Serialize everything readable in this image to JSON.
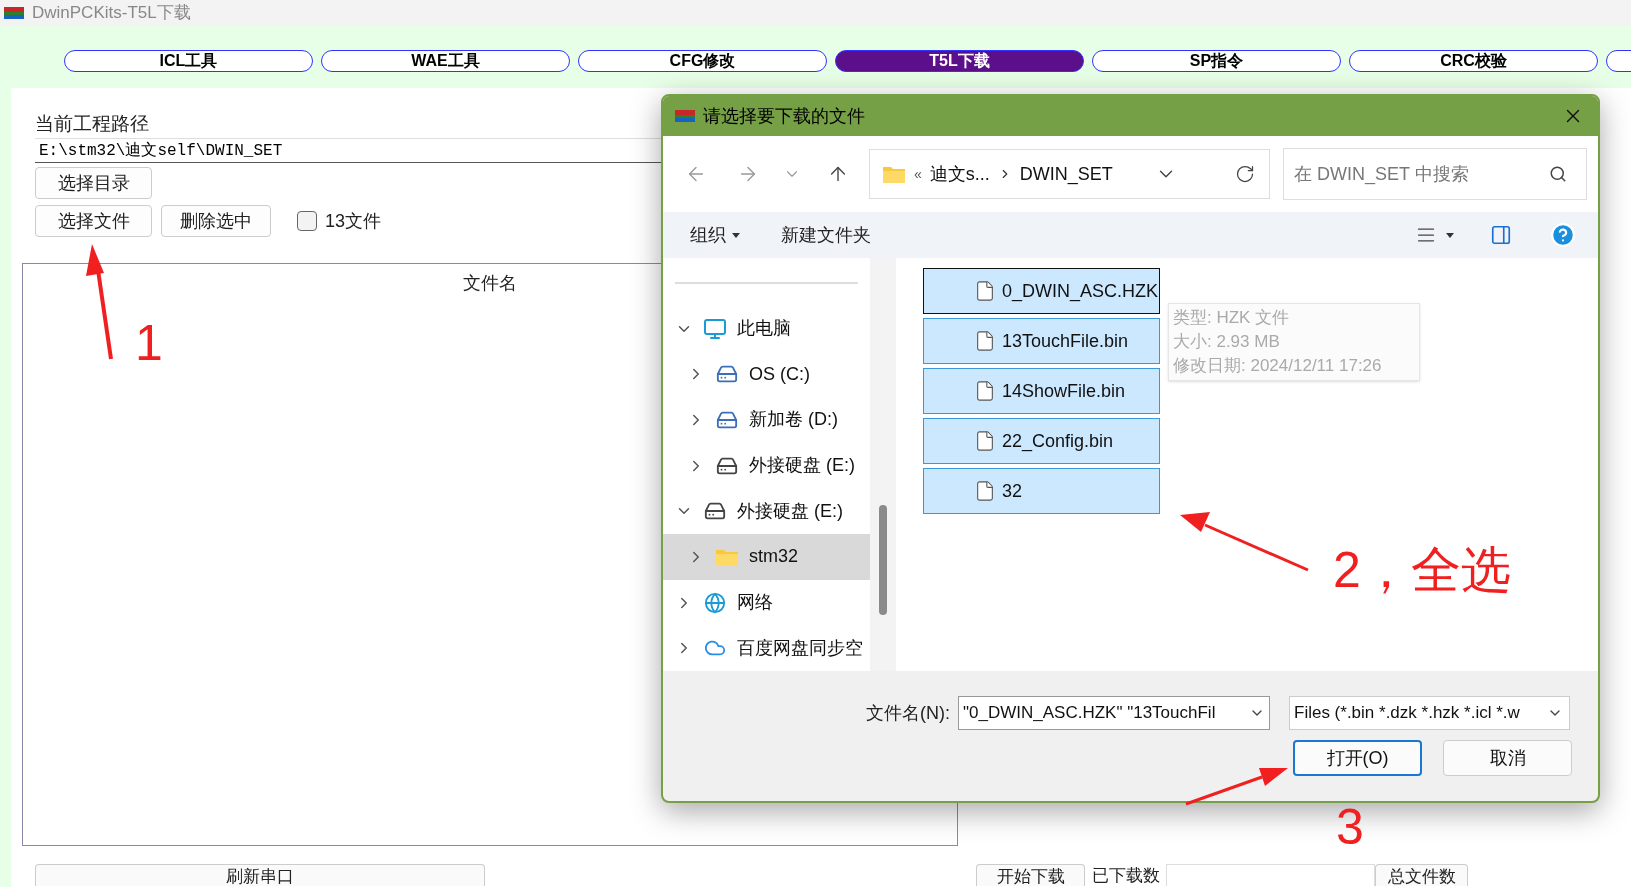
{
  "window": {
    "title": "DwinPCKits-T5L下载"
  },
  "tabs": [
    {
      "label": "ICL工具",
      "selected": false
    },
    {
      "label": "WAE工具",
      "selected": false
    },
    {
      "label": "CFG修改",
      "selected": false
    },
    {
      "label": "T5L下载",
      "selected": true
    },
    {
      "label": "SP指令",
      "selected": false
    },
    {
      "label": "CRC校验",
      "selected": false
    }
  ],
  "project": {
    "path_label": "当前工程路径",
    "path": "E:\\stm32\\迪文self\\DWIN_SET",
    "dir_button": "选择目录",
    "buttons": [
      "选择文件",
      "删除选中"
    ],
    "checkbox": {
      "label": "13文件",
      "checked": false
    }
  },
  "file_table": {
    "columns": [
      "文件名"
    ]
  },
  "bottom_bar": {
    "refresh_button": "刷新串口",
    "start_button": "开始下载",
    "downloaded_label": "已下载数",
    "total_button": "总文件数"
  },
  "dialog": {
    "title": "请选择要下载的文件",
    "breadcrumb": {
      "prefix": "«",
      "items": [
        "迪文s...",
        "DWIN_SET"
      ]
    },
    "search": {
      "placeholder": "在 DWIN_SET 中搜索"
    },
    "toolbar": {
      "organize": "组织",
      "new_folder": "新建文件夹"
    },
    "tree": [
      {
        "label": "此电脑",
        "kind": "pc",
        "expanded": true,
        "selected": false,
        "children": [
          {
            "label": "OS (C:)",
            "kind": "os-drive",
            "expanded": false,
            "selected": false
          },
          {
            "label": "新加卷 (D:)",
            "kind": "os-drive",
            "expanded": false,
            "selected": false
          },
          {
            "label": "外接硬盘 (E:)",
            "kind": "drive",
            "expanded": false,
            "selected": false
          }
        ]
      },
      {
        "label": "外接硬盘 (E:)",
        "kind": "drive",
        "expanded": true,
        "selected": false,
        "children": [
          {
            "label": "stm32",
            "kind": "folder",
            "expanded": false,
            "selected": true
          }
        ]
      },
      {
        "label": "网络",
        "kind": "network",
        "expanded": false,
        "selected": false
      },
      {
        "label": "百度网盘同步空",
        "kind": "cloud",
        "expanded": false,
        "selected": false
      }
    ],
    "files": [
      {
        "name": "0_DWIN_ASC.HZK",
        "selected": true,
        "focused": true
      },
      {
        "name": "13TouchFile.bin",
        "selected": true,
        "focused": false
      },
      {
        "name": "14ShowFile.bin",
        "selected": true,
        "focused": false
      },
      {
        "name": "22_Config.bin",
        "selected": true,
        "focused": false
      },
      {
        "name": "32",
        "selected": true,
        "focused": false
      }
    ],
    "tooltip": [
      "类型: HZK 文件",
      "大小: 2.93 MB",
      "修改日期: 2024/12/11 17:26"
    ],
    "filename": {
      "label": "文件名(N):",
      "value": "\"0_DWIN_ASC.HZK\" \"13TouchFil"
    },
    "filter": "Files (*.bin *.dzk *.hzk *.icl *.w",
    "buttons": [
      {
        "label": "打开(O)",
        "kind": "primary"
      },
      {
        "label": "取消",
        "kind": "normal"
      }
    ]
  },
  "annotations": [
    {
      "text": "1"
    },
    {
      "text": "2，全选"
    },
    {
      "text": "3"
    }
  ]
}
